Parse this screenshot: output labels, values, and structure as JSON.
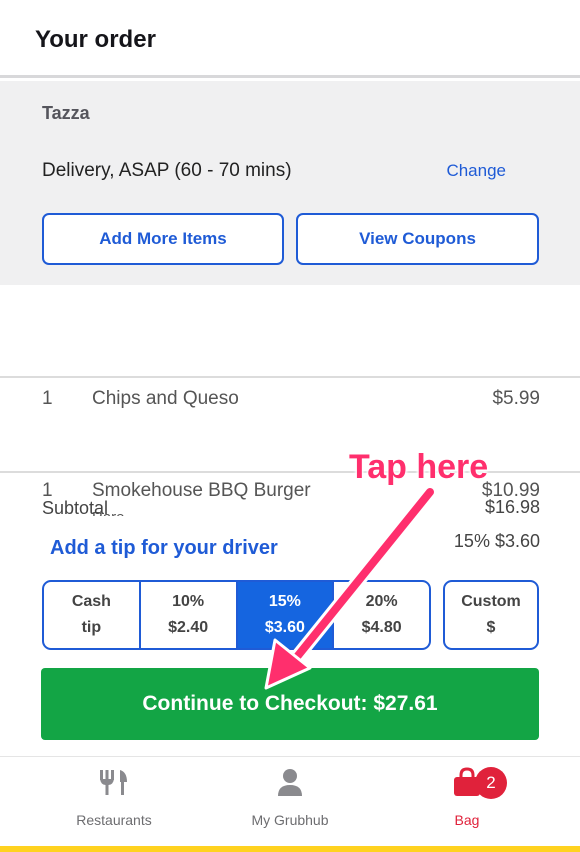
{
  "header": {
    "title": "Your order"
  },
  "restaurant": {
    "name": "Tazza",
    "delivery": "Delivery, ASAP (60 - 70 mins)",
    "change_label": "Change",
    "add_more_label": "Add More Items",
    "coupons_label": "View Coupons"
  },
  "items": [
    {
      "qty": "1",
      "name": "Chips and Queso",
      "price": "$5.99",
      "note": ""
    },
    {
      "qty": "1",
      "name": "Smokehouse BBQ Burger",
      "price": "$10.99",
      "note": "Rare"
    }
  ],
  "summary": {
    "subtotal_label": "Subtotal",
    "subtotal_value": "$16.98"
  },
  "tip": {
    "title": "Add a tip for your driver",
    "selected_display": "15% $3.60",
    "options": [
      {
        "label": "Cash",
        "sub": "tip"
      },
      {
        "label": "10%",
        "sub": "$2.40"
      },
      {
        "label": "15%",
        "sub": "$3.60"
      },
      {
        "label": "20%",
        "sub": "$4.80"
      }
    ],
    "custom": {
      "label": "Custom",
      "sub": "$"
    }
  },
  "checkout": {
    "label": "Continue to Checkout: $27.61"
  },
  "nav": {
    "restaurants": "Restaurants",
    "mygrubhub": "My Grubhub",
    "bag": "Bag",
    "bag_count": "2"
  },
  "annotation": {
    "text": "Tap here"
  },
  "colors": {
    "accent": "#1f5bd6",
    "checkout": "#13a545",
    "bag": "#e0223b",
    "annotation": "#ff2f6d"
  }
}
